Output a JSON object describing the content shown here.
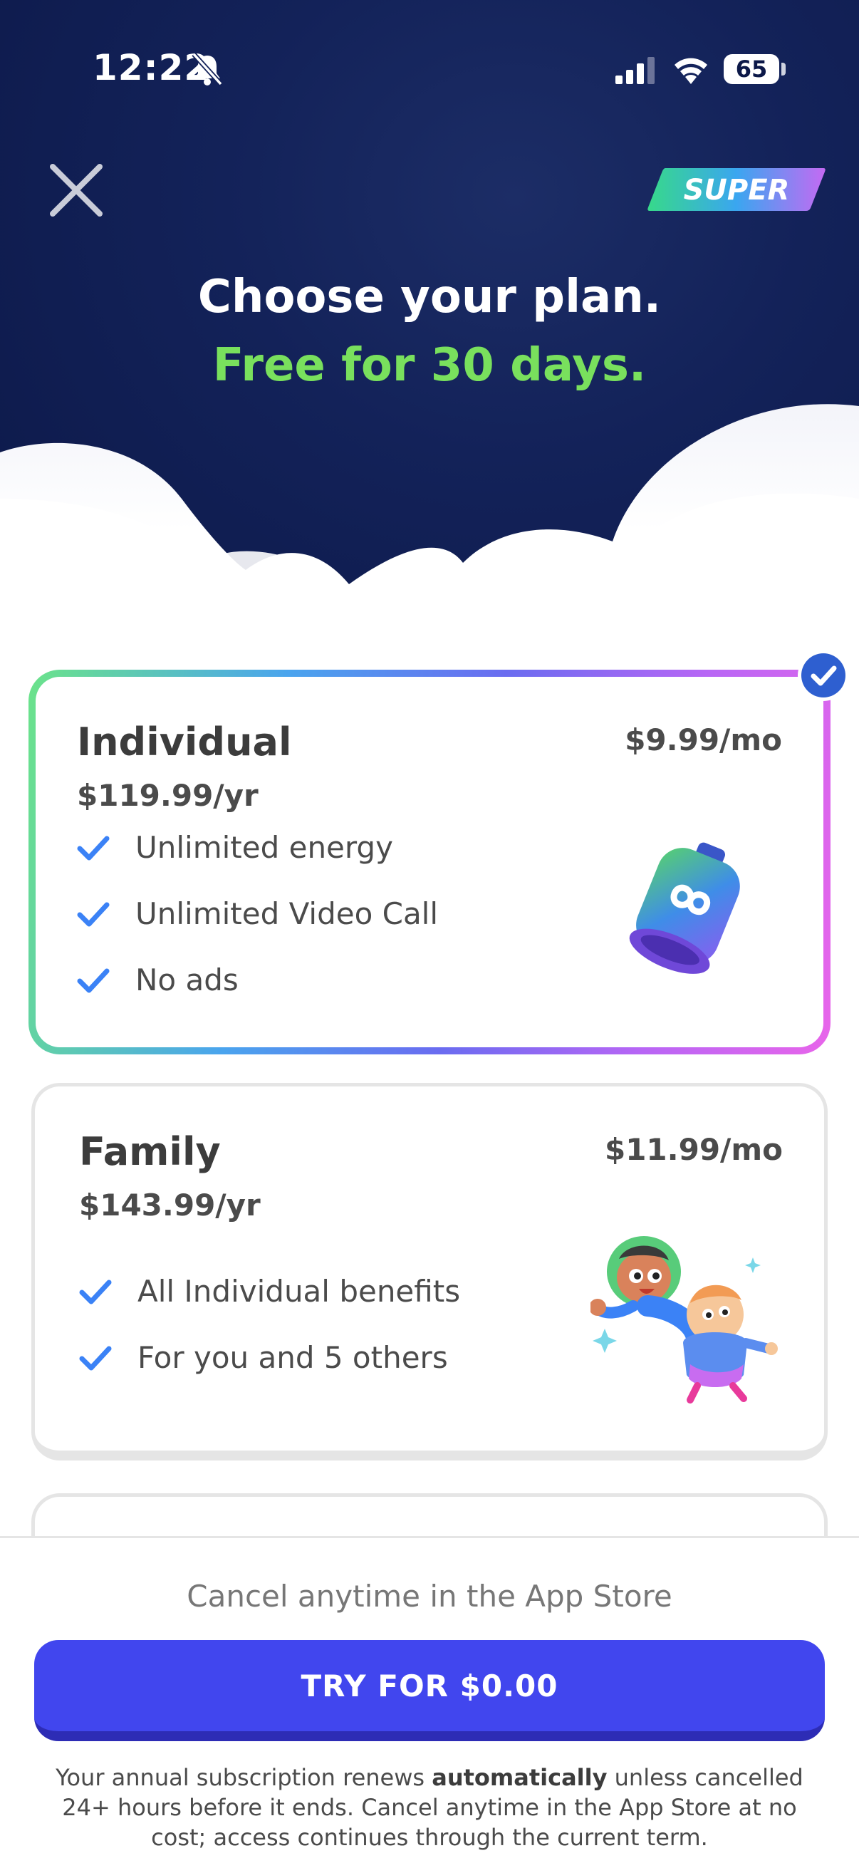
{
  "status_bar": {
    "time": "12:22",
    "battery": "65"
  },
  "header": {
    "badge_label": "SUPER",
    "title": "Choose your plan.",
    "subtitle": "Free for 30 days."
  },
  "plans": [
    {
      "name": "Individual",
      "price_monthly": "$9.99/mo",
      "price_yearly": "$119.99/yr",
      "features": [
        "Unlimited energy",
        "Unlimited Video Call",
        "No ads"
      ],
      "selected": true
    },
    {
      "name": "Family",
      "price_monthly": "$11.99/mo",
      "price_yearly": "$143.99/yr",
      "features": [
        "All Individual benefits",
        "For you and 5 others"
      ],
      "selected": false
    }
  ],
  "footer": {
    "cancel_note": "Cancel anytime in the App Store",
    "cta_label": "TRY FOR $0.00",
    "legal_before": "Your annual subscription renews ",
    "legal_bold": "automatically",
    "legal_after": " unless cancelled 24+ hours before it ends. Cancel anytime in the App Store at no cost; access continues through the current term."
  },
  "colors": {
    "sky": "#132259",
    "subtitle_green": "#79e05d",
    "cta_blue": "#4146ee",
    "check_blue": "#3b82f6"
  },
  "icons": [
    "bell-slash-icon",
    "signal-icon",
    "wifi-icon",
    "close-icon",
    "check-icon",
    "infinity-battery-icon",
    "family-characters-icon"
  ]
}
